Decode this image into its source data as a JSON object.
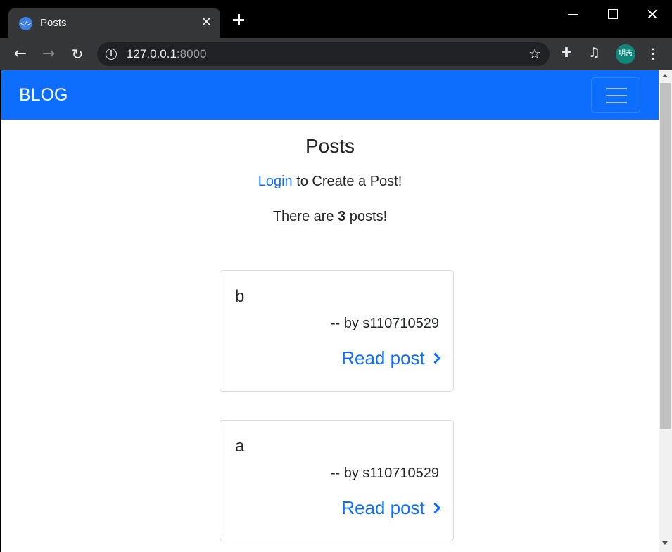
{
  "browser": {
    "tab_title": "Posts",
    "url_host": "127.0.0.1",
    "url_port": ":8000",
    "profile_initials": "明志"
  },
  "navbar": {
    "brand": "BLOG"
  },
  "page": {
    "title": "Posts",
    "login_link": "Login",
    "login_suffix": " to Create a Post!",
    "count_prefix": "There are ",
    "count": "3",
    "count_suffix": " posts!"
  },
  "posts": [
    {
      "title": "b",
      "author": "-- by s110710529",
      "link": "Read post"
    },
    {
      "title": "a",
      "author": "-- by s110710529",
      "link": "Read post"
    }
  ],
  "colors": {
    "primary": "#0d6efd",
    "chrome_dark": "#353637",
    "avatar": "#12867a"
  }
}
